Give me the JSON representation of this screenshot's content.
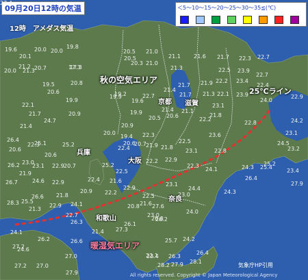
{
  "title": "09月20日12時の気温",
  "subtitle": "12時　アメダス気温",
  "legend": {
    "text": "＜5〜10〜15〜20〜25〜30〜35≦(℃)",
    "colors": [
      "#1a1aff",
      "#a0c8ff",
      "#00a040",
      "#60d060",
      "#ffff00",
      "#ff9900",
      "#ff2020",
      "#a000a0"
    ]
  },
  "annotations": {
    "autumn_air": "秋の空気エリア",
    "line_25": "25℃ライン",
    "humid_air": "暖湿気エリア"
  },
  "line_color": "#e53030",
  "prefectures": [
    "京都",
    "滋賀",
    "兵庫",
    "大阪",
    "奈良",
    "和歌山"
  ],
  "credit": "All rights reserved. Copyright © Japan Meteorological Agency",
  "source": "気象庁HP引用",
  "stations": [
    "19.6",
    "20.0",
    "20.0",
    "19.8",
    "17.3",
    "20.5",
    "21.0",
    "21.1",
    "21.6",
    "21.7",
    "22.3",
    "22.7",
    "20.1",
    "21.2",
    "20.7",
    "17.3",
    "20.5",
    "20.3",
    "21.0",
    "21.3",
    "22.5",
    "23.9",
    "22.7",
    "20.0",
    "21.3",
    "19.5",
    "20.8",
    "19.9",
    "21.4",
    "21.7",
    "21.9",
    "22.2",
    "23.4",
    "22.4",
    "20.6",
    "22.1",
    "19.9",
    "19.2",
    "21.7",
    "21.3",
    "23.9",
    "20.9",
    "21.7",
    "19.6",
    "22.7",
    "22.1",
    "23.1",
    "24.0",
    "24.7",
    "21.4",
    "20.9",
    "21.4",
    "21.1",
    "22.2",
    "22.9",
    "25.1",
    "20.6",
    "19.9",
    "20.5",
    "20.6",
    "21.8",
    "22.8",
    "24.2",
    "25.2",
    "20.6",
    "22.3",
    "20.7",
    "20.0",
    "19.4",
    "22.3",
    "22.5",
    "23.1",
    "26.4",
    "20.6",
    "22.4",
    "21.8",
    "21.9",
    "23.6",
    "24.5",
    "25.2",
    "20.7",
    "21.6",
    "22.2",
    "22.9",
    "23.1",
    "24.1",
    "25.4",
    "26.2",
    "23.1",
    "22.9",
    "23.0",
    "20.9",
    "22.3",
    "22.8",
    "24.1",
    "24.6",
    "21.9",
    "22.9",
    "23.2",
    "26.7",
    "22.9",
    "22.4",
    "22.5",
    "23.1",
    "24.3",
    "25.2",
    "26.6",
    "21.8",
    "22.2",
    "24.4",
    "23.0",
    "24.3",
    "23.4",
    "28.3",
    "22.9",
    "20.8",
    "24.0",
    "26.4",
    "27.9",
    "25.5",
    "21.3",
    "22.5",
    "23.0",
    "26.2",
    "24.1",
    "22.7",
    "21.6",
    "27.6",
    "27.3",
    "27.2",
    "21.4",
    "26.1",
    "25.7",
    "26.8",
    "24.6",
    "26.3",
    "24.2",
    "26.4",
    "26.2",
    "22.1",
    "23.4",
    "26.3",
    "27.0",
    "26.6",
    "28.1",
    "27.2",
    "27.0",
    "27.9",
    "27.9",
    "28.2",
    "27.4"
  ]
}
